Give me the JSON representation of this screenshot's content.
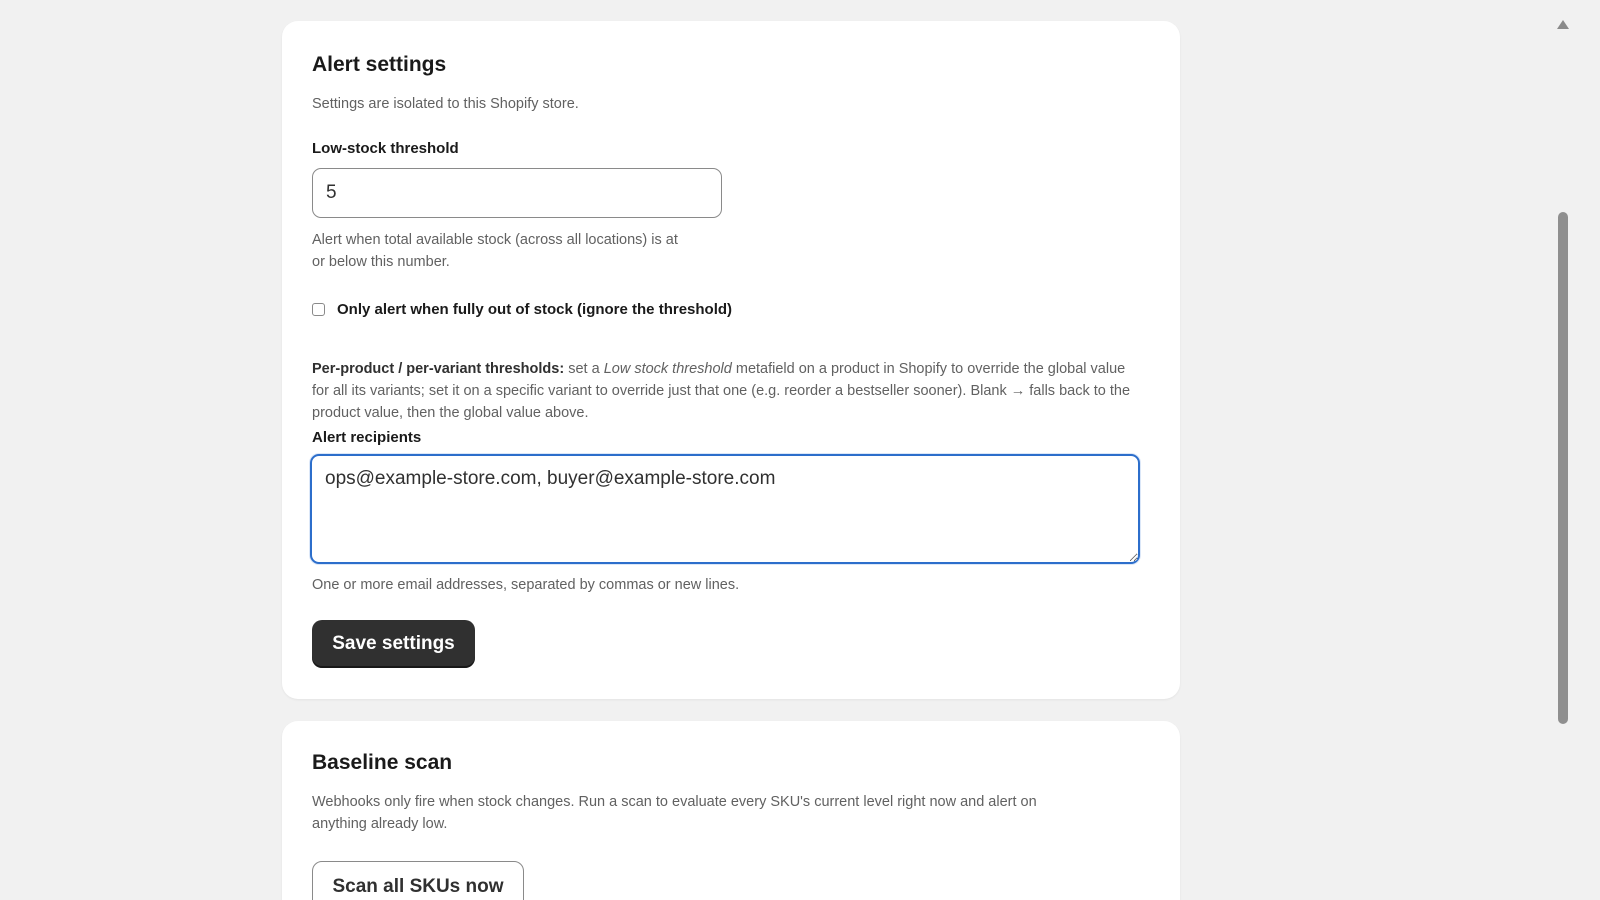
{
  "alert_settings": {
    "title": "Alert settings",
    "subtitle": "Settings are isolated to this Shopify store.",
    "threshold_label": "Low-stock threshold",
    "threshold_value": "5",
    "threshold_help_1": "Alert when total available stock (across all locations) is at",
    "threshold_help_2": "or below this number.",
    "only_out_of_stock_label": "Only alert when fully out of stock (ignore the threshold)",
    "only_out_of_stock_checked": false,
    "per_product_bold": "Per-product / per-variant thresholds:",
    "per_product_text_a": " set a ",
    "per_product_italic": "Low stock threshold",
    "per_product_text_b": " metafield on a product in Shopify to override the global value for all its variants; set it on a specific variant to override just that one (e.g. reorder a bestseller sooner). Blank → falls back to the product value, then the global value above.",
    "recipients_label": "Alert recipients",
    "recipients_value": "ops@example-store.com, buyer@example-store.com",
    "recipients_help": "One or more email addresses, separated by commas or new lines.",
    "save_label": "Save settings"
  },
  "baseline_scan": {
    "title": "Baseline scan",
    "description_1": "Webhooks only fire when stock changes. Run a scan to evaluate every SKU's current level right now and alert on",
    "description_2": "anything already low.",
    "scan_label": "Scan all SKUs now"
  },
  "colors": {
    "primary_button": "#303030",
    "focus_border": "#2c6ecb",
    "page_background": "#f1f1f1"
  }
}
